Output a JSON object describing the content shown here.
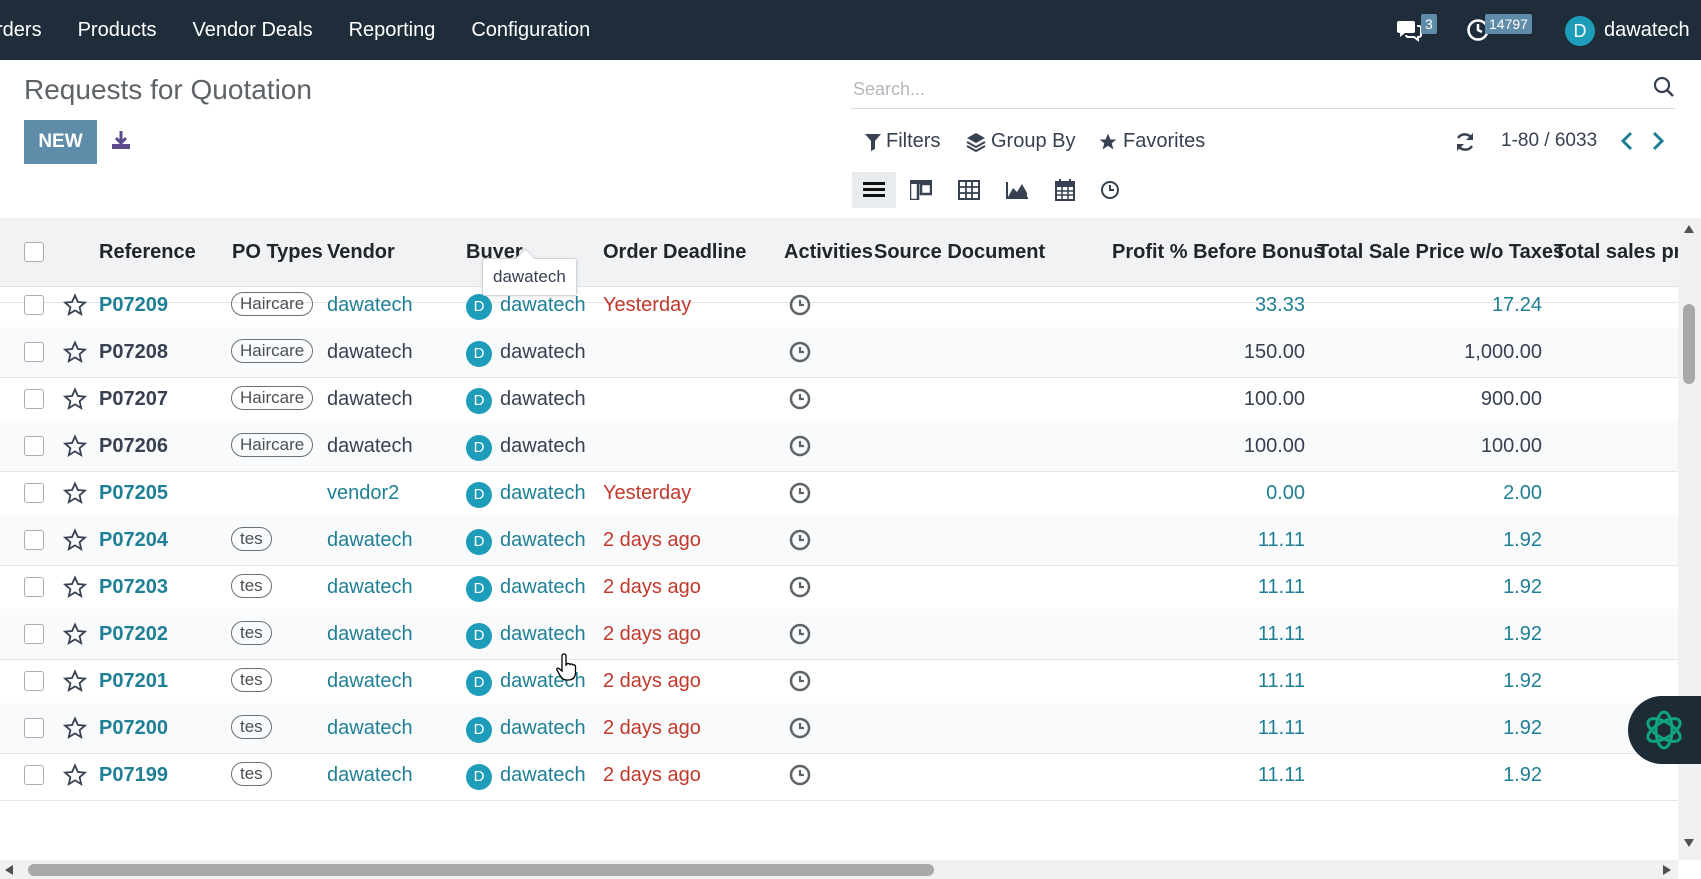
{
  "navbar": {
    "menu": [
      "rders",
      "Products",
      "Vendor Deals",
      "Reporting",
      "Configuration"
    ],
    "messages_count": "3",
    "activities_count": "14797",
    "user_initial": "D",
    "user_name": "dawatech"
  },
  "control_panel": {
    "title": "Requests for Quotation",
    "new_label": "NEW",
    "search_placeholder": "Search...",
    "filters_label": "Filters",
    "groupby_label": "Group By",
    "favorites_label": "Favorites",
    "pager": "1-80 / 6033"
  },
  "table": {
    "headers": {
      "reference": "Reference",
      "po_types": "PO Types",
      "vendor": "Vendor",
      "buyer": "Buyer",
      "order_deadline": "Order Deadline",
      "activities": "Activities",
      "source_document": "Source Document",
      "profit": "Profit % Before Bonus",
      "total_sale": "Total Sale Price w/o Taxes",
      "total_sales_price": "Total sales pric"
    },
    "rows": [
      {
        "ref": "P07209",
        "tag": "Haircare",
        "vendor": "dawatech",
        "buyer": "dawatech",
        "deadline": "Yesterday",
        "profit": "33.33",
        "total": "17.24",
        "link": true
      },
      {
        "ref": "P07208",
        "tag": "Haircare",
        "vendor": "dawatech",
        "buyer": "dawatech",
        "deadline": "",
        "profit": "150.00",
        "total": "1,000.00",
        "link": false
      },
      {
        "ref": "P07207",
        "tag": "Haircare",
        "vendor": "dawatech",
        "buyer": "dawatech",
        "deadline": "",
        "profit": "100.00",
        "total": "900.00",
        "link": false
      },
      {
        "ref": "P07206",
        "tag": "Haircare",
        "vendor": "dawatech",
        "buyer": "dawatech",
        "deadline": "",
        "profit": "100.00",
        "total": "100.00",
        "link": false
      },
      {
        "ref": "P07205",
        "tag": "",
        "vendor": "vendor2",
        "buyer": "dawatech",
        "deadline": "Yesterday",
        "profit": "0.00",
        "total": "2.00",
        "link": true
      },
      {
        "ref": "P07204",
        "tag": "tes",
        "vendor": "dawatech",
        "buyer": "dawatech",
        "deadline": "2 days ago",
        "profit": "11.11",
        "total": "1.92",
        "link": true
      },
      {
        "ref": "P07203",
        "tag": "tes",
        "vendor": "dawatech",
        "buyer": "dawatech",
        "deadline": "2 days ago",
        "profit": "11.11",
        "total": "1.92",
        "link": true
      },
      {
        "ref": "P07202",
        "tag": "tes",
        "vendor": "dawatech",
        "buyer": "dawatech",
        "deadline": "2 days ago",
        "profit": "11.11",
        "total": "1.92",
        "link": true
      },
      {
        "ref": "P07201",
        "tag": "tes",
        "vendor": "dawatech",
        "buyer": "dawatech",
        "deadline": "2 days ago",
        "profit": "11.11",
        "total": "1.92",
        "link": true
      },
      {
        "ref": "P07200",
        "tag": "tes",
        "vendor": "dawatech",
        "buyer": "dawatech",
        "deadline": "2 days ago",
        "profit": "11.11",
        "total": "1.92",
        "link": true
      },
      {
        "ref": "P07199",
        "tag": "tes",
        "vendor": "dawatech",
        "buyer": "dawatech",
        "deadline": "2 days ago",
        "profit": "11.11",
        "total": "1.92",
        "link": true
      }
    ],
    "avatar_initial": "D"
  },
  "tooltip": {
    "text": "dawatech"
  },
  "colors": {
    "navbar": "#1f2d3a",
    "primary": "#5f8ca8",
    "link": "#1f7f94",
    "danger": "#c0392b",
    "avatar": "#1e9dba"
  },
  "icons": [
    "chat-icon",
    "clock-icon",
    "download-icon",
    "search-icon",
    "filter-icon",
    "layers-icon",
    "star-icon",
    "refresh-icon",
    "chevron-left-icon",
    "chevron-right-icon",
    "list-view-icon",
    "kanban-view-icon",
    "pivot-view-icon",
    "graph-view-icon",
    "calendar-view-icon",
    "activity-view-icon",
    "openai-icon"
  ]
}
